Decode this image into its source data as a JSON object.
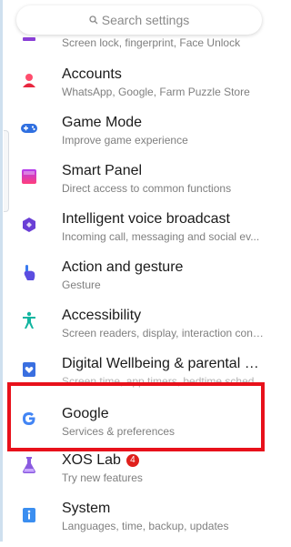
{
  "search": {
    "placeholder": "Search settings"
  },
  "items": [
    {
      "title": "",
      "subtitle": "Screen lock, fingerprint, Face Unlock",
      "icon": "security-icon"
    },
    {
      "title": "Accounts",
      "subtitle": "WhatsApp, Google, Farm Puzzle Store",
      "icon": "accounts-icon"
    },
    {
      "title": "Game Mode",
      "subtitle": "Improve game experience",
      "icon": "gamepad-icon"
    },
    {
      "title": "Smart Panel",
      "subtitle": "Direct access to common functions",
      "icon": "smart-panel-icon"
    },
    {
      "title": "Intelligent voice broadcast",
      "subtitle": "Incoming call, messaging and social ev...",
      "icon": "voice-broadcast-icon"
    },
    {
      "title": "Action and gesture",
      "subtitle": "Gesture",
      "icon": "hand-gesture-icon"
    },
    {
      "title": "Accessibility",
      "subtitle": "Screen readers, display, interaction conte...",
      "icon": "accessibility-icon"
    },
    {
      "title": "Digital Wellbeing & parental con...",
      "subtitle": "Screen time, app timers, bedtime sched...",
      "icon": "digital-wellbeing-icon"
    },
    {
      "title": "Google",
      "subtitle": "Services & preferences",
      "icon": "google-icon"
    },
    {
      "title": "XOS Lab",
      "subtitle": "Try new features",
      "icon": "lab-flask-icon",
      "badge": "4"
    },
    {
      "title": "System",
      "subtitle": "Languages, time, backup, updates",
      "icon": "system-info-icon"
    }
  ],
  "colors": {
    "highlight": "#e8111b",
    "badge": "#e0201c"
  }
}
